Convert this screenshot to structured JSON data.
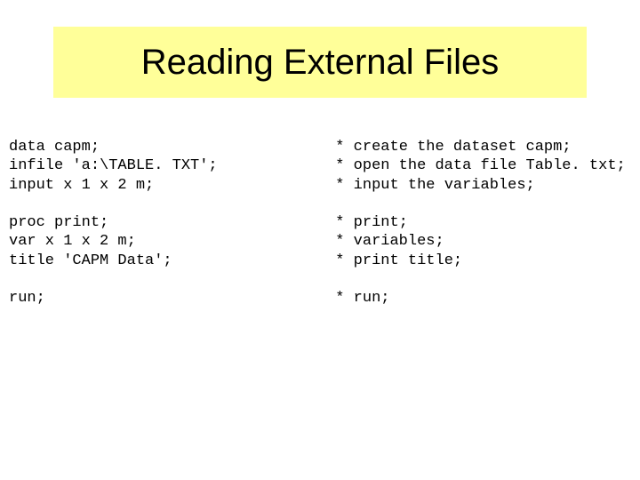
{
  "title": "Reading External Files",
  "code": {
    "block1": {
      "l1": {
        "left": "data capm;",
        "right": "* create the dataset capm;"
      },
      "l2": {
        "left": "infile 'a:\\TABLE. TXT';",
        "right": "* open the data file Table. txt;"
      },
      "l3": {
        "left": "input x 1 x 2 m;",
        "right": "* input the variables;"
      }
    },
    "block2": {
      "l1": {
        "left": "proc print;",
        "right": "* print;"
      },
      "l2": {
        "left": "var x 1 x 2 m;",
        "right": "* variables;"
      },
      "l3": {
        "left": "title 'CAPM Data';",
        "right": "* print title;"
      }
    },
    "block3": {
      "l1": {
        "left": "run;",
        "right": "* run;"
      }
    }
  }
}
